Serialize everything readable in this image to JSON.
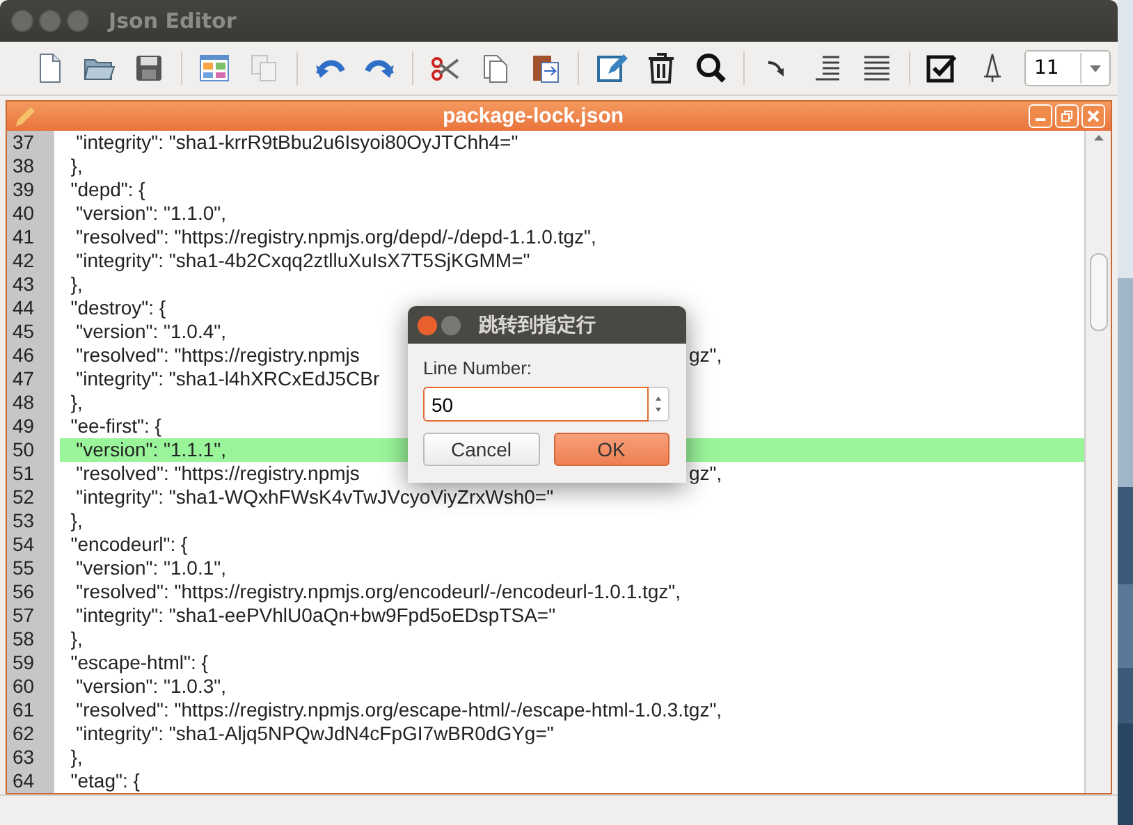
{
  "window": {
    "title": "Json Editor"
  },
  "toolbar": [
    {
      "kind": "new",
      "disabled": false
    },
    {
      "kind": "open",
      "disabled": false
    },
    {
      "kind": "save",
      "disabled": false
    },
    {
      "kind": "sep"
    },
    {
      "kind": "grid",
      "disabled": false
    },
    {
      "kind": "pages",
      "disabled": true
    },
    {
      "kind": "sep"
    },
    {
      "kind": "undo",
      "disabled": false
    },
    {
      "kind": "redo",
      "disabled": false
    },
    {
      "kind": "sep"
    },
    {
      "kind": "cut",
      "disabled": false
    },
    {
      "kind": "copy",
      "disabled": false
    },
    {
      "kind": "paste",
      "disabled": false
    },
    {
      "kind": "sep"
    },
    {
      "kind": "edit",
      "disabled": false
    },
    {
      "kind": "trash",
      "disabled": false
    },
    {
      "kind": "search",
      "disabled": false
    },
    {
      "kind": "sep"
    },
    {
      "kind": "arrow",
      "disabled": false
    },
    {
      "kind": "indent",
      "disabled": false
    },
    {
      "kind": "justify",
      "disabled": false
    },
    {
      "kind": "sep"
    },
    {
      "kind": "checkbox",
      "disabled": false
    },
    {
      "kind": "pin",
      "disabled": false
    }
  ],
  "font_size": {
    "value": "11"
  },
  "document": {
    "title": "package-lock.json"
  },
  "lines": [
    {
      "number": "37",
      "text": "   \"integrity\": \"sha1-krrR9tBbu2u6Isyoi80OyJTChh4=\"",
      "selected": false
    },
    {
      "number": "38",
      "text": "  },",
      "selected": false
    },
    {
      "number": "39",
      "text": "  \"depd\": {",
      "selected": false
    },
    {
      "number": "40",
      "text": "   \"version\": \"1.1.0\",",
      "selected": false
    },
    {
      "number": "41",
      "text": "   \"resolved\": \"https://registry.npmjs.org/depd/-/depd-1.1.0.tgz\",",
      "selected": false
    },
    {
      "number": "42",
      "text": "   \"integrity\": \"sha1-4b2Cxqq2ztlluXuIsX7T5SjKGMM=\"",
      "selected": false
    },
    {
      "number": "43",
      "text": "  },",
      "selected": false
    },
    {
      "number": "44",
      "text": "  \"destroy\": {",
      "selected": false
    },
    {
      "number": "45",
      "text": "   \"version\": \"1.0.4\",",
      "selected": false
    },
    {
      "number": "46",
      "text": "   \"resolved\": \"https://registry.npmjs",
      "tail": "gz\",",
      "selected": false
    },
    {
      "number": "47",
      "text": "   \"integrity\": \"sha1-l4hXRCxEdJ5CBr",
      "selected": false
    },
    {
      "number": "48",
      "text": "  },",
      "selected": false
    },
    {
      "number": "49",
      "text": "  \"ee-first\": {",
      "selected": false
    },
    {
      "number": "50",
      "text": "   \"version\": \"1.1.1\",",
      "selected": true
    },
    {
      "number": "51",
      "text": "   \"resolved\": \"https://registry.npmjs",
      "tail": "gz\",",
      "selected": false
    },
    {
      "number": "52",
      "text": "   \"integrity\": \"sha1-WQxhFWsK4vTwJVcyoViyZrxWsh0=\"",
      "selected": false
    },
    {
      "number": "53",
      "text": "  },",
      "selected": false
    },
    {
      "number": "54",
      "text": "  \"encodeurl\": {",
      "selected": false
    },
    {
      "number": "55",
      "text": "   \"version\": \"1.0.1\",",
      "selected": false
    },
    {
      "number": "56",
      "text": "   \"resolved\": \"https://registry.npmjs.org/encodeurl/-/encodeurl-1.0.1.tgz\",",
      "selected": false
    },
    {
      "number": "57",
      "text": "   \"integrity\": \"sha1-eePVhlU0aQn+bw9Fpd5oEDspTSA=\"",
      "selected": false
    },
    {
      "number": "58",
      "text": "  },",
      "selected": false
    },
    {
      "number": "59",
      "text": "  \"escape-html\": {",
      "selected": false
    },
    {
      "number": "60",
      "text": "   \"version\": \"1.0.3\",",
      "selected": false
    },
    {
      "number": "61",
      "text": "   \"resolved\": \"https://registry.npmjs.org/escape-html/-/escape-html-1.0.3.tgz\",",
      "selected": false
    },
    {
      "number": "62",
      "text": "   \"integrity\": \"sha1-Aljq5NPQwJdN4cFpGI7wBR0dGYg=\"",
      "selected": false
    },
    {
      "number": "63",
      "text": "  },",
      "selected": false
    },
    {
      "number": "64",
      "text": "  \"etag\": {",
      "selected": false
    }
  ],
  "dialog": {
    "title": "跳转到指定行",
    "label": "Line Number:",
    "value": "50",
    "buttons": [
      {
        "label": "Cancel",
        "kind": "normal"
      },
      {
        "label": "OK",
        "kind": "default"
      }
    ]
  }
}
